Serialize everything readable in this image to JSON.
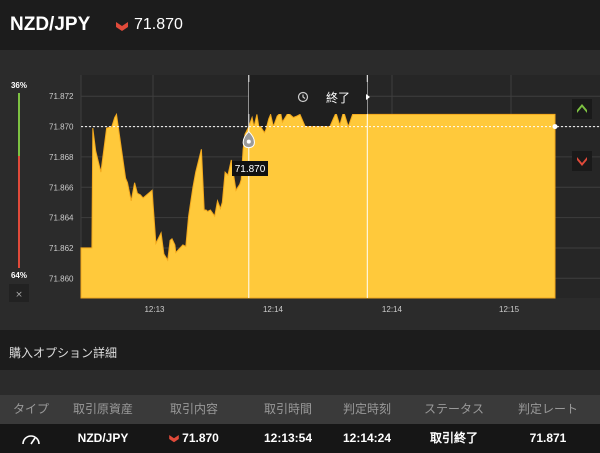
{
  "header": {
    "pair": "NZD/JPY",
    "rate": "71.870",
    "trend": "down",
    "trend_color": "#e04a3a"
  },
  "chart": {
    "percent_top": "36%",
    "percent_bottom": "64%",
    "close_icon": "×",
    "end_label": "終了",
    "current_rate_label": "71.870",
    "up_button_icon": "chevron-up-icon",
    "down_button_icon": "chevron-down-icon",
    "fill_color": "#ffc93b",
    "up_color": "#7dc142",
    "down_color": "#e04a3a"
  },
  "chart_data": {
    "type": "area",
    "ylim": [
      71.8587,
      71.8734
    ],
    "xlim": [
      0,
      100
    ],
    "y_ticks": [
      "71.872",
      "71.870",
      "71.868",
      "71.866",
      "71.864",
      "71.862",
      "71.860"
    ],
    "y_tick_values": [
      71.872,
      71.87,
      71.868,
      71.866,
      71.864,
      71.862,
      71.86
    ],
    "x_ticks": [
      "12:13",
      "12:14",
      "12:14",
      "12:15"
    ],
    "x_tick_positions": [
      15.5,
      40.5,
      65.6,
      90.3
    ],
    "entry_rate": 71.87,
    "entry_marker_x": 35.4,
    "purchase_line_x": 35.4,
    "end_line_x": 60.4,
    "x": [
      0,
      2.3,
      2.5,
      3.1,
      4.2,
      5.4,
      6.5,
      7.1,
      7.5,
      9.4,
      9.8,
      10.6,
      11.3,
      11.9,
      12.5,
      13.1,
      15.0,
      15.8,
      16.9,
      17.5,
      18.3,
      18.8,
      19.2,
      19.8,
      20.0,
      21.5,
      22.1,
      22.7,
      23.6,
      24.2,
      25.4,
      26.0,
      26.4,
      26.7,
      27.3,
      28.2,
      28.8,
      29.4,
      29.8,
      30.4,
      31.0,
      31.7,
      32.7,
      33.5,
      33.8,
      34.2,
      34.6,
      35.4,
      36.1,
      36.5,
      37.1,
      37.5,
      37.9,
      38.7,
      39.0,
      39.6,
      40.0,
      40.6,
      41.4,
      42.1,
      42.5,
      43.7,
      44.8,
      45.6,
      46.2,
      47.3,
      48.3,
      49.1,
      50.0,
      51.0,
      51.9,
      52.5,
      53.2,
      53.8,
      54.6,
      55.4,
      56.4,
      57.3,
      58.1,
      58.9,
      59.8,
      60.4,
      61.7,
      62.9,
      63.6,
      64.5,
      65.6,
      66.6,
      68.1,
      69.1,
      70.0,
      71.0,
      72.4,
      73.3,
      74.5,
      75.4,
      76.3,
      77.1,
      78.1,
      79.0,
      80.2,
      81.1,
      81.7,
      82.3,
      82.7,
      83.5,
      84.4,
      85.8,
      86.7,
      87.7,
      88.1,
      88.7,
      89.3,
      89.9,
      90.4,
      91.2,
      91.8,
      92.5,
      93.4,
      94.2,
      95.1,
      95.8,
      96.4,
      96.8,
      97.7,
      98.3,
      98.7,
      99.2,
      100
    ],
    "y": [
      71.862,
      71.862,
      71.8699,
      71.8684,
      71.867,
      71.8699,
      71.87,
      71.8706,
      71.8708,
      71.8666,
      71.8663,
      71.8651,
      71.8663,
      71.8656,
      71.8655,
      71.8653,
      71.8658,
      71.8623,
      71.863,
      71.8616,
      71.8612,
      71.8625,
      71.8626,
      71.8622,
      71.8617,
      71.8622,
      71.8621,
      71.8641,
      71.866,
      71.867,
      71.8685,
      71.8645,
      71.8645,
      71.8644,
      71.8645,
      71.8641,
      71.8651,
      71.8646,
      71.865,
      71.867,
      71.8668,
      71.8678,
      71.8658,
      71.8662,
      71.8665,
      71.8685,
      71.8695,
      71.87,
      71.8706,
      71.87,
      71.8708,
      71.87,
      71.87,
      71.8696,
      71.8698,
      71.8705,
      71.8708,
      71.87,
      71.8707,
      71.8709,
      71.8703,
      71.8709,
      71.8706,
      71.8707,
      71.8708,
      71.87,
      71.87,
      71.87,
      71.87,
      71.87,
      71.87,
      71.87,
      71.8705,
      71.8709,
      71.8701,
      71.871,
      71.87,
      71.8708,
      71.8708,
      71.8708,
      71.8708,
      71.8708,
      71.8708,
      71.8708,
      71.8708,
      71.8708,
      71.8708,
      71.8708,
      71.8708,
      71.8708,
      71.8708,
      71.8708,
      71.8708,
      71.8708,
      71.8708,
      71.8708,
      71.8708,
      71.8708,
      71.8708,
      71.8708,
      71.8708,
      71.8708,
      71.8708,
      71.8708,
      71.8708,
      71.8708,
      71.8708,
      71.8708,
      71.8708,
      71.8708,
      71.8708,
      71.8708,
      71.8708,
      71.8708,
      71.8708,
      71.8708,
      71.8708,
      71.8708,
      71.8708,
      71.8708,
      71.8708,
      71.8708,
      71.8708,
      71.8708,
      71.8708,
      71.8708,
      71.8708,
      71.8708,
      71.8708
    ]
  },
  "section": {
    "title": "購入オプション詳細"
  },
  "table": {
    "headers": [
      "タイプ",
      "取引原資産",
      "取引内容",
      "取引時間",
      "判定時刻",
      "ステータス",
      "判定レート"
    ],
    "row": {
      "type_icon": "gauge-icon",
      "asset": "NZD/JPY",
      "direction": "down",
      "rate": "71.870",
      "trade_time": "12:13:54",
      "judge_time": "12:14:24",
      "status": "取引終了",
      "judge_rate": "71.871"
    }
  }
}
